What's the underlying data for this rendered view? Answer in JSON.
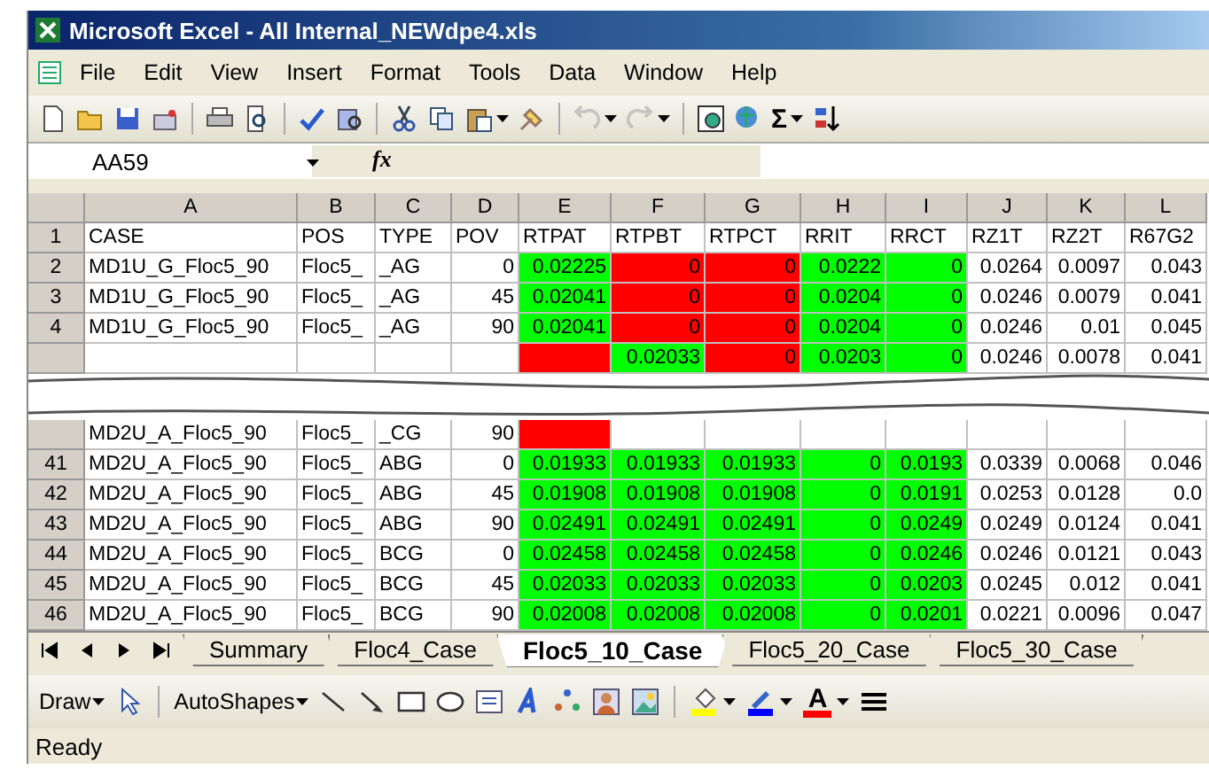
{
  "window": {
    "title": "Microsoft Excel - All Internal_NEWdpe4.xls"
  },
  "menu": [
    {
      "label": "File"
    },
    {
      "label": "Edit"
    },
    {
      "label": "View"
    },
    {
      "label": "Insert"
    },
    {
      "label": "Format"
    },
    {
      "label": "Tools"
    },
    {
      "label": "Data"
    },
    {
      "label": "Window"
    },
    {
      "label": "Help"
    }
  ],
  "standard_toolbar": {
    "undo": {
      "disabled": true
    },
    "redo": {
      "disabled": true
    },
    "sum_glyph": "Σ"
  },
  "formula_bar": {
    "name_box": "AA59",
    "fx_glyph": "fx"
  },
  "table": {
    "columns": [
      {
        "letter": "A",
        "kind": "text"
      },
      {
        "letter": "B",
        "kind": "text"
      },
      {
        "letter": "C",
        "kind": "text"
      },
      {
        "letter": "D",
        "kind": "number"
      },
      {
        "letter": "E",
        "kind": "number"
      },
      {
        "letter": "F",
        "kind": "number"
      },
      {
        "letter": "G",
        "kind": "number"
      },
      {
        "letter": "H",
        "kind": "number"
      },
      {
        "letter": "I",
        "kind": "number"
      },
      {
        "letter": "J",
        "kind": "number"
      },
      {
        "letter": "K",
        "kind": "number"
      },
      {
        "letter": "L",
        "kind": "number"
      }
    ],
    "top_rows": [
      {
        "header": "1",
        "kind": "header",
        "cells": [
          {
            "text": "CASE"
          },
          {
            "text": "POS"
          },
          {
            "text": "TYPE"
          },
          {
            "text": "POV"
          },
          {
            "text": "RTPAT"
          },
          {
            "text": "RTPBT"
          },
          {
            "text": "RTPCT"
          },
          {
            "text": "RRIT"
          },
          {
            "text": "RRCT"
          },
          {
            "text": "RZ1T"
          },
          {
            "text": "RZ2T"
          },
          {
            "text": "R67G2"
          }
        ]
      },
      {
        "header": "2",
        "cells": [
          {
            "text": "MD1U_G_Floc5_90"
          },
          {
            "text": "Floc5_"
          },
          {
            "text": "_AG"
          },
          {
            "text": "0"
          },
          {
            "text": "0.02225",
            "color": "#00ff00"
          },
          {
            "text": "0",
            "color": "#ff0000"
          },
          {
            "text": "0",
            "color": "#ff0000"
          },
          {
            "text": "0.0222",
            "color": "#00ff00"
          },
          {
            "text": "0",
            "color": "#00ff00"
          },
          {
            "text": "0.0264"
          },
          {
            "text": "0.0097"
          },
          {
            "text": "0.043"
          }
        ]
      },
      {
        "header": "3",
        "cells": [
          {
            "text": "MD1U_G_Floc5_90"
          },
          {
            "text": "Floc5_"
          },
          {
            "text": "_AG"
          },
          {
            "text": "45"
          },
          {
            "text": "0.02041",
            "color": "#00ff00"
          },
          {
            "text": "0",
            "color": "#ff0000"
          },
          {
            "text": "0",
            "color": "#ff0000"
          },
          {
            "text": "0.0204",
            "color": "#00ff00"
          },
          {
            "text": "0",
            "color": "#00ff00"
          },
          {
            "text": "0.0246"
          },
          {
            "text": "0.0079"
          },
          {
            "text": "0.041"
          }
        ]
      },
      {
        "header": "4",
        "cells": [
          {
            "text": "MD1U_G_Floc5_90"
          },
          {
            "text": "Floc5_"
          },
          {
            "text": "_AG"
          },
          {
            "text": "90"
          },
          {
            "text": "0.02041",
            "color": "#00ff00"
          },
          {
            "text": "0",
            "color": "#ff0000"
          },
          {
            "text": "0",
            "color": "#ff0000"
          },
          {
            "text": "0.0204",
            "color": "#00ff00"
          },
          {
            "text": "0",
            "color": "#00ff00"
          },
          {
            "text": "0.0246"
          },
          {
            "text": "0.01"
          },
          {
            "text": "0.045"
          }
        ]
      },
      {
        "cells": [
          {},
          {},
          {},
          {},
          {
            "color": "#ff0000"
          },
          {
            "text": "0.02033",
            "color": "#00ff00"
          },
          {
            "text": "0",
            "color": "#ff0000"
          },
          {
            "text": "0.0203",
            "color": "#00ff00"
          },
          {
            "text": "0",
            "color": "#00ff00"
          },
          {
            "text": "0.0246"
          },
          {
            "text": "0.0078"
          },
          {
            "text": "0.041"
          }
        ]
      }
    ],
    "bottom_rows": [
      {
        "cells": [
          {
            "text": "MD2U_A_Floc5_90"
          },
          {
            "text": "Floc5_"
          },
          {
            "text": "_CG"
          },
          {
            "text": "90"
          },
          {
            "color": "#ff0000"
          },
          {},
          {},
          {},
          {},
          {},
          {},
          {}
        ]
      },
      {
        "header": "41",
        "cells": [
          {
            "text": "MD2U_A_Floc5_90"
          },
          {
            "text": "Floc5_"
          },
          {
            "text": "ABG"
          },
          {
            "text": "0"
          },
          {
            "text": "0.01933",
            "color": "#00ff00"
          },
          {
            "text": "0.01933",
            "color": "#00ff00"
          },
          {
            "text": "0.01933",
            "color": "#00ff00"
          },
          {
            "text": "0",
            "color": "#00ff00"
          },
          {
            "text": "0.0193",
            "color": "#00ff00"
          },
          {
            "text": "0.0339"
          },
          {
            "text": "0.0068"
          },
          {
            "text": "0.046"
          }
        ]
      },
      {
        "header": "42",
        "cells": [
          {
            "text": "MD2U_A_Floc5_90"
          },
          {
            "text": "Floc5_"
          },
          {
            "text": "ABG"
          },
          {
            "text": "45"
          },
          {
            "text": "0.01908",
            "color": "#00ff00"
          },
          {
            "text": "0.01908",
            "color": "#00ff00"
          },
          {
            "text": "0.01908",
            "color": "#00ff00"
          },
          {
            "text": "0",
            "color": "#00ff00"
          },
          {
            "text": "0.0191",
            "color": "#00ff00"
          },
          {
            "text": "0.0253"
          },
          {
            "text": "0.0128"
          },
          {
            "text": "0.0"
          }
        ]
      },
      {
        "header": "43",
        "cells": [
          {
            "text": "MD2U_A_Floc5_90"
          },
          {
            "text": "Floc5_"
          },
          {
            "text": "ABG"
          },
          {
            "text": "90"
          },
          {
            "text": "0.02491",
            "color": "#00ff00"
          },
          {
            "text": "0.02491",
            "color": "#00ff00"
          },
          {
            "text": "0.02491",
            "color": "#00ff00"
          },
          {
            "text": "0",
            "color": "#00ff00"
          },
          {
            "text": "0.0249",
            "color": "#00ff00"
          },
          {
            "text": "0.0249"
          },
          {
            "text": "0.0124"
          },
          {
            "text": "0.041"
          }
        ]
      },
      {
        "header": "44",
        "cells": [
          {
            "text": "MD2U_A_Floc5_90"
          },
          {
            "text": "Floc5_"
          },
          {
            "text": "BCG"
          },
          {
            "text": "0"
          },
          {
            "text": "0.02458",
            "color": "#00ff00"
          },
          {
            "text": "0.02458",
            "color": "#00ff00"
          },
          {
            "text": "0.02458",
            "color": "#00ff00"
          },
          {
            "text": "0",
            "color": "#00ff00"
          },
          {
            "text": "0.0246",
            "color": "#00ff00"
          },
          {
            "text": "0.0246"
          },
          {
            "text": "0.0121"
          },
          {
            "text": "0.043"
          }
        ]
      },
      {
        "header": "45",
        "cells": [
          {
            "text": "MD2U_A_Floc5_90"
          },
          {
            "text": "Floc5_"
          },
          {
            "text": "BCG"
          },
          {
            "text": "45"
          },
          {
            "text": "0.02033",
            "color": "#00ff00"
          },
          {
            "text": "0.02033",
            "color": "#00ff00"
          },
          {
            "text": "0.02033",
            "color": "#00ff00"
          },
          {
            "text": "0",
            "color": "#00ff00"
          },
          {
            "text": "0.0203",
            "color": "#00ff00"
          },
          {
            "text": "0.0245"
          },
          {
            "text": "0.012"
          },
          {
            "text": "0.041"
          }
        ]
      },
      {
        "header": "46",
        "cells": [
          {
            "text": "MD2U_A_Floc5_90"
          },
          {
            "text": "Floc5_"
          },
          {
            "text": "BCG"
          },
          {
            "text": "90"
          },
          {
            "text": "0.02008",
            "color": "#00ff00"
          },
          {
            "text": "0.02008",
            "color": "#00ff00"
          },
          {
            "text": "0.02008",
            "color": "#00ff00"
          },
          {
            "text": "0",
            "color": "#00ff00"
          },
          {
            "text": "0.0201",
            "color": "#00ff00"
          },
          {
            "text": "0.0221"
          },
          {
            "text": "0.0096"
          },
          {
            "text": "0.047"
          }
        ]
      }
    ]
  },
  "sheet_tabs": [
    {
      "label": "Summary",
      "selected": false
    },
    {
      "label": "Floc4_Case",
      "selected": false
    },
    {
      "label": "Floc5_10_Case",
      "selected": true
    },
    {
      "label": "Floc5_20_Case",
      "selected": false
    },
    {
      "label": "Floc5_30_Case",
      "selected": false
    }
  ],
  "drawing_toolbar": {
    "draw": "Draw",
    "autoshapes": "AutoShapes",
    "font_color_glyph": "A"
  },
  "status_bar": {
    "text": "Ready"
  }
}
